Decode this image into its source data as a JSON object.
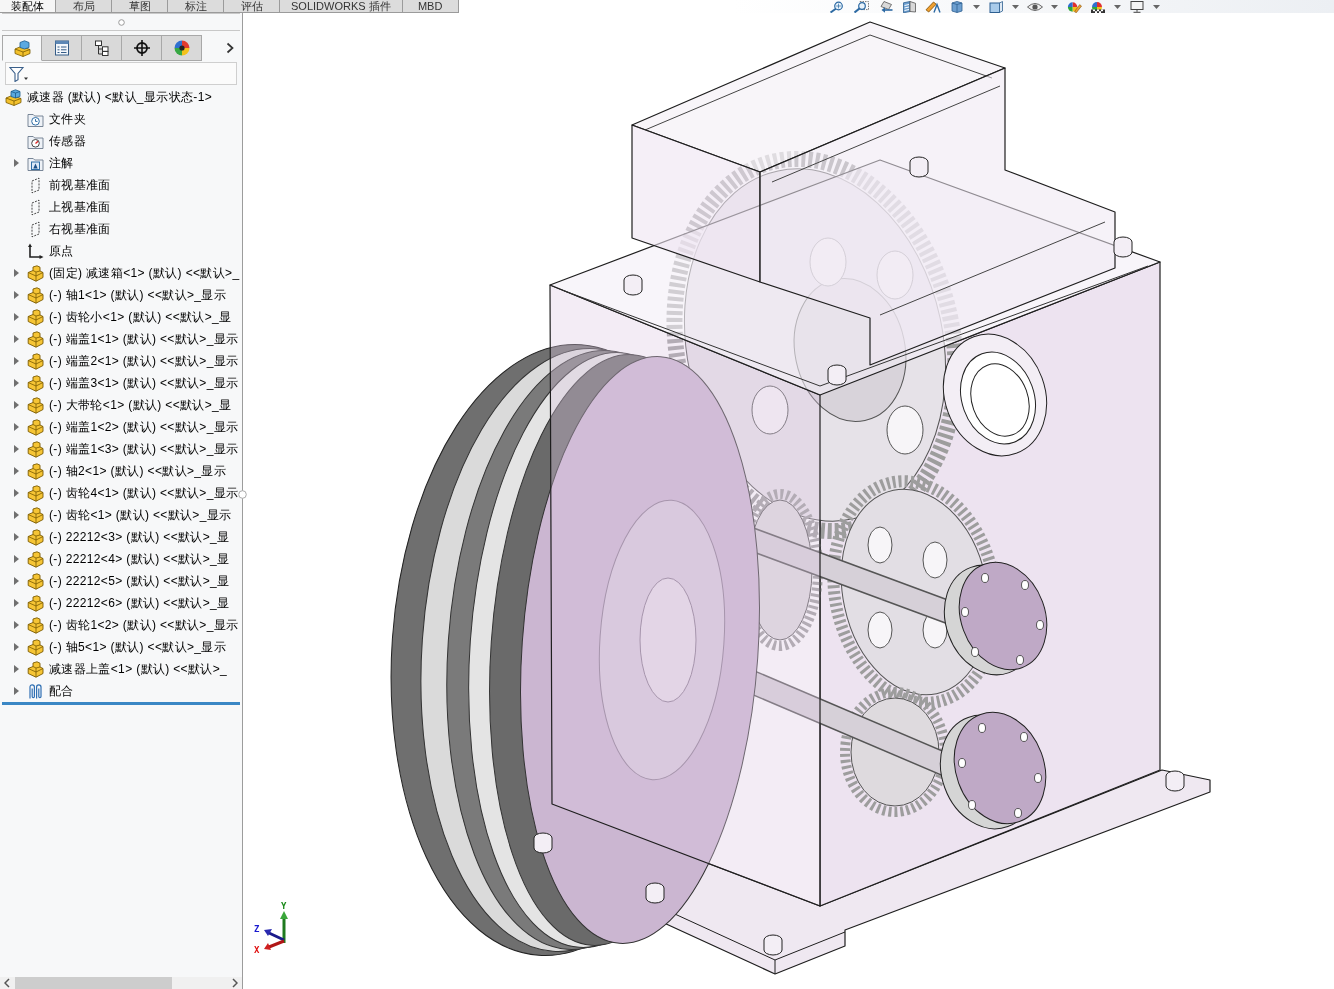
{
  "command_tabs": [
    {
      "label": "装配体",
      "selected": true
    },
    {
      "label": "布局",
      "selected": false
    },
    {
      "label": "草图",
      "selected": false
    },
    {
      "label": "标注",
      "selected": false
    },
    {
      "label": "评估",
      "selected": false
    },
    {
      "label": "SOLIDWORKS 插件",
      "selected": false
    },
    {
      "label": "MBD",
      "selected": false
    }
  ],
  "panel": {
    "tabs": [
      {
        "selected": true
      },
      {
        "selected": false
      },
      {
        "selected": false
      },
      {
        "selected": false
      },
      {
        "selected": false
      }
    ],
    "tree": {
      "label": "减速器 (默认) <默认_显示状态-1>",
      "kind": "assembly",
      "children": [
        {
          "label": "文件夹",
          "kind": "folder-history"
        },
        {
          "label": "传感器",
          "kind": "folder-sensor"
        },
        {
          "label": "注解",
          "kind": "annotations",
          "expanded": false
        },
        {
          "label": "前视基准面",
          "kind": "plane"
        },
        {
          "label": "上视基准面",
          "kind": "plane"
        },
        {
          "label": "右视基准面",
          "kind": "plane"
        },
        {
          "label": "原点",
          "kind": "origin"
        },
        {
          "label": "(固定) 减速箱<1> (默认) <<默认>_",
          "kind": "part",
          "expanded": false
        },
        {
          "label": "(-) 轴1<1> (默认) <<默认>_显示",
          "kind": "part",
          "expanded": false
        },
        {
          "label": "(-) 齿轮小<1> (默认) <<默认>_显",
          "kind": "part",
          "expanded": false
        },
        {
          "label": "(-) 端盖1<1> (默认) <<默认>_显示",
          "kind": "part",
          "expanded": false
        },
        {
          "label": "(-) 端盖2<1> (默认) <<默认>_显示",
          "kind": "part",
          "expanded": false
        },
        {
          "label": "(-) 端盖3<1> (默认) <<默认>_显示",
          "kind": "part",
          "expanded": false
        },
        {
          "label": "(-) 大带轮<1> (默认) <<默认>_显",
          "kind": "part",
          "expanded": false
        },
        {
          "label": "(-) 端盖1<2> (默认) <<默认>_显示",
          "kind": "part",
          "expanded": false
        },
        {
          "label": "(-) 端盖1<3> (默认) <<默认>_显示",
          "kind": "part",
          "expanded": false
        },
        {
          "label": "(-) 轴2<1> (默认) <<默认>_显示",
          "kind": "part",
          "expanded": false
        },
        {
          "label": "(-) 齿轮4<1> (默认) <<默认>_显示",
          "kind": "part",
          "expanded": false
        },
        {
          "label": "(-) 齿轮<1> (默认) <<默认>_显示",
          "kind": "part",
          "expanded": false
        },
        {
          "label": "(-) 22212<3> (默认) <<默认>_显",
          "kind": "part",
          "expanded": false
        },
        {
          "label": "(-) 22212<4> (默认) <<默认>_显",
          "kind": "part",
          "expanded": false
        },
        {
          "label": "(-) 22212<5> (默认) <<默认>_显",
          "kind": "part",
          "expanded": false
        },
        {
          "label": "(-) 22212<6> (默认) <<默认>_显",
          "kind": "part",
          "expanded": false
        },
        {
          "label": "(-) 齿轮1<2> (默认) <<默认>_显示",
          "kind": "part",
          "expanded": false
        },
        {
          "label": "(-) 轴5<1> (默认) <<默认>_显示",
          "kind": "part",
          "expanded": false
        },
        {
          "label": "减速器上盖<1> (默认) <<默认>_",
          "kind": "part",
          "expanded": false
        },
        {
          "label": "配合",
          "kind": "mates",
          "expanded": false
        }
      ]
    }
  },
  "view": {
    "triad": {
      "x": "X",
      "y": "Y",
      "z": "Z"
    }
  }
}
